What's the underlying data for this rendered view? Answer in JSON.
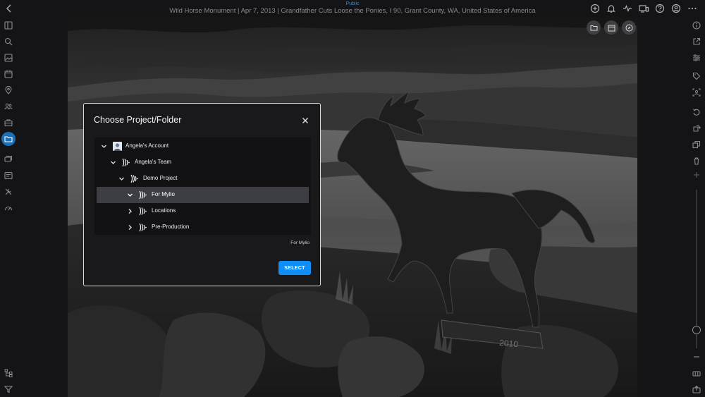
{
  "header": {
    "visibility": "Public",
    "title": "Wild Horse Monument | Apr 7, 2013 | Grandfather Cuts Loose the Ponies, I 90, Grant County, WA, United States of America",
    "icons": [
      "add-icon",
      "bell-icon",
      "activity-icon",
      "devices-icon",
      "help-icon",
      "account-icon",
      "more-icon"
    ]
  },
  "left_sidebar": {
    "icons": [
      "info-panel-icon",
      "search-icon",
      "photos-icon",
      "calendar-icon",
      "map-pin-icon",
      "people-icon",
      "briefcase-icon",
      "folder-icon",
      "albums-icon",
      "tag-card-icon",
      "tools-icon",
      "gauge-icon",
      "hierarchy-icon",
      "filter-icon"
    ],
    "active": "folder-icon"
  },
  "right_sidebar": {
    "icons": [
      "info-icon",
      "external-link-icon",
      "adjust-icon",
      "tag-icon",
      "people-tag-icon",
      "rotate-left-icon",
      "rotate-right-icon",
      "copy-icon",
      "trash-icon",
      "plus-icon",
      "zoom-out-icon",
      "grid-icon",
      "export-icon"
    ]
  },
  "photo_actions": [
    "folder-add-icon",
    "calendar-icon",
    "compass-icon"
  ],
  "dialog": {
    "title": "Choose Project/Folder",
    "selected_path": "For Mylio",
    "select_button": "SELECT",
    "tree": [
      {
        "label": "Angela's Account",
        "level": 0,
        "expanded": true,
        "icon": "avatar-icon",
        "selected": false
      },
      {
        "label": "Angela's Team",
        "level": 1,
        "expanded": true,
        "icon": "frameio-icon",
        "selected": false
      },
      {
        "label": "Demo Project",
        "level": 2,
        "expanded": true,
        "icon": "frameio-icon",
        "selected": false
      },
      {
        "label": "For Mylio",
        "level": 3,
        "expanded": true,
        "icon": "frameio-icon",
        "selected": true
      },
      {
        "label": "Locations",
        "level": 3,
        "expanded": false,
        "icon": "frameio-icon",
        "selected": false
      },
      {
        "label": "Pre-Production",
        "level": 3,
        "expanded": false,
        "icon": "frameio-icon",
        "selected": false
      }
    ]
  },
  "colors": {
    "accent": "#0f8ef7",
    "active_nav": "#1b6fb5",
    "selected_row": "#3d3e44",
    "dialog_bg": "#19191c",
    "visibility_text": "#2e8fd6"
  }
}
